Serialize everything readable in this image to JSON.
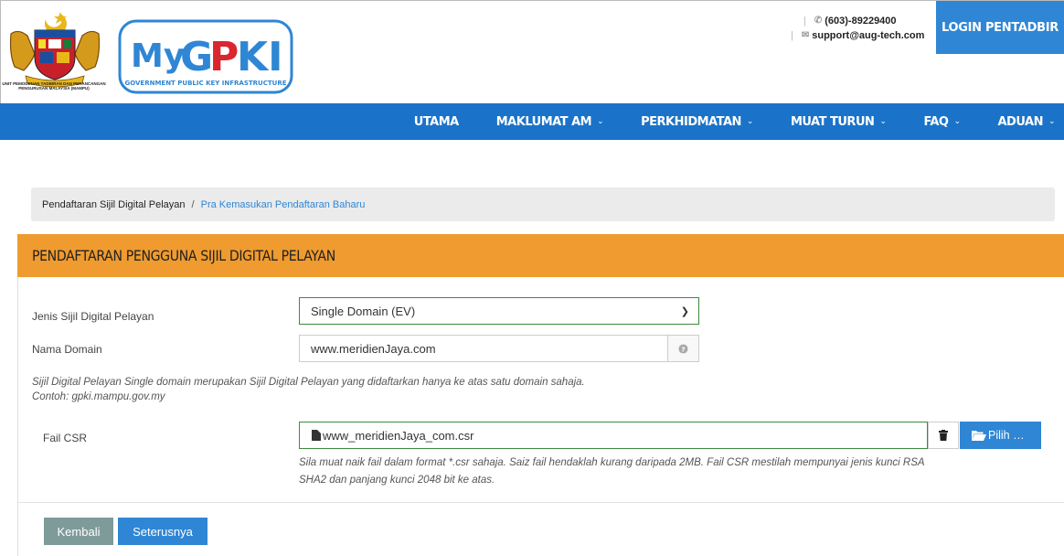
{
  "header": {
    "agency_caption": "UNIT PEMODENAN TADBIRAN DAN PERANCANGAN PENGURUSAN MALAYSIA (MAMPU)",
    "logo_text": "MyGPKI",
    "logo_subtitle": "GOVERNMENT PUBLIC KEY INFRASTRUCTURE",
    "phone": "(603)-89229400",
    "email": "support@aug-tech.com",
    "login_label": "LOGIN PENTADBIR"
  },
  "nav": {
    "items": [
      {
        "label": "UTAMA",
        "has_dropdown": false
      },
      {
        "label": "MAKLUMAT AM",
        "has_dropdown": true
      },
      {
        "label": "PERKHIDMATAN",
        "has_dropdown": true
      },
      {
        "label": "MUAT TURUN",
        "has_dropdown": true
      },
      {
        "label": "FAQ",
        "has_dropdown": true
      },
      {
        "label": "ADUAN",
        "has_dropdown": true
      }
    ]
  },
  "breadcrumb": {
    "parent": "Pendaftaran Sijil Digital Pelayan",
    "current": "Pra Kemasukan Pendaftaran Baharu"
  },
  "panel": {
    "title": "PENDAFTARAN PENGGUNA SIJIL DIGITAL PELAYAN"
  },
  "form": {
    "cert_type": {
      "label": "Jenis Sijil Digital Pelayan",
      "value": "Single Domain (EV)"
    },
    "domain": {
      "label": "Nama Domain",
      "value": "www.meridienJaya.com"
    },
    "domain_help_1": "Sijil Digital Pelayan Single domain merupakan Sijil Digital Pelayan yang didaftarkan hanya ke atas satu domain sahaja.",
    "domain_help_2": "Contoh: gpki.mampu.gov.my",
    "csr": {
      "label": "Fail CSR",
      "value": "www_meridienJaya_com.csr",
      "browse_label": "Pilih …"
    },
    "csr_help_1": "Sila muat naik fail dalam format *.csr sahaja. Saiz fail hendaklah kurang daripada 2MB. Fail CSR mestilah mempunyai jenis kunci RSA",
    "csr_help_2": "SHA2 dan panjang kunci 2048 bit ke atas."
  },
  "actions": {
    "back_label": "Kembali",
    "next_label": "Seterusnya"
  },
  "colors": {
    "nav_bg": "#1a73c9",
    "accent_blue": "#2f86d4",
    "panel_header": "#ef9b2f",
    "back_button": "#7e9a99",
    "valid_border": "#3d8a3d"
  },
  "icons": {
    "phone": "phone-icon",
    "email": "envelope-icon",
    "help": "question-circle-icon",
    "file": "file-icon",
    "delete": "trash-icon",
    "browse": "folder-open-icon",
    "dropdown": "chevron-down-icon"
  }
}
